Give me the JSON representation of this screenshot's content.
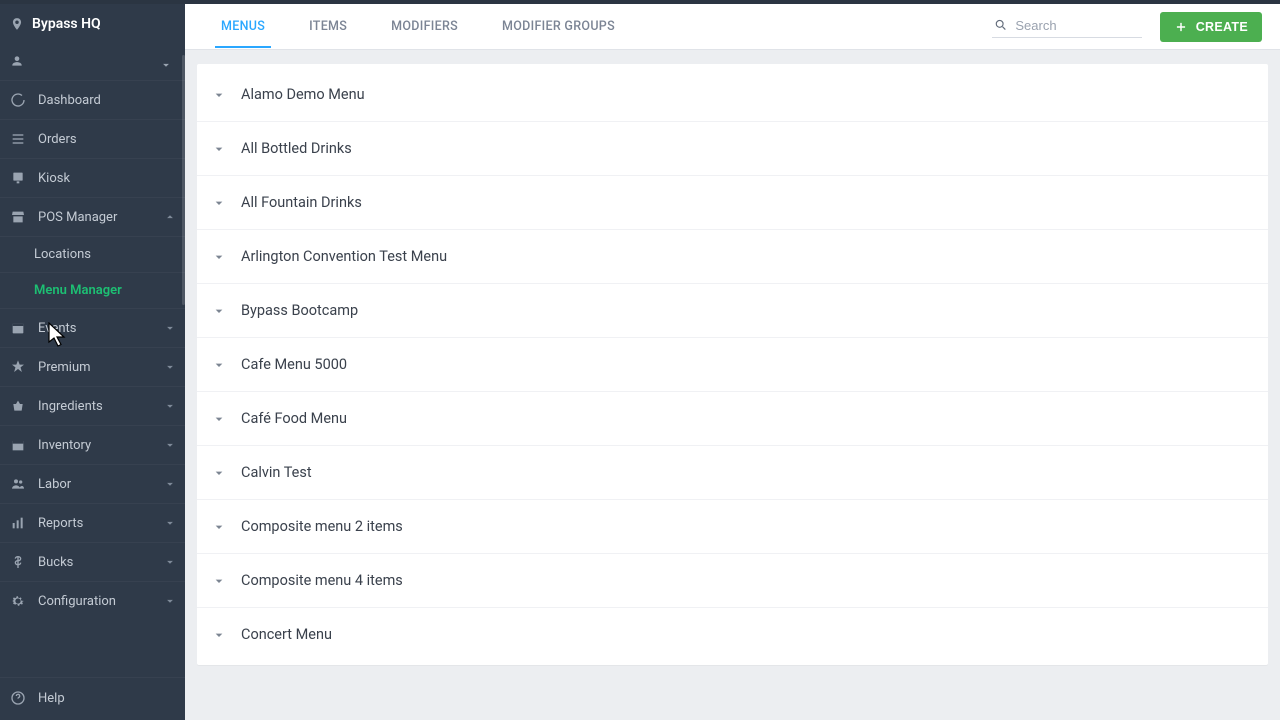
{
  "brand": {
    "name": "Bypass HQ"
  },
  "sidebar": {
    "items": [
      {
        "label": "Dashboard",
        "icon": "refresh",
        "expandable": false
      },
      {
        "label": "Orders",
        "icon": "list",
        "expandable": false
      },
      {
        "label": "Kiosk",
        "icon": "kiosk",
        "expandable": false
      },
      {
        "label": "POS Manager",
        "icon": "store",
        "expandable": true,
        "expanded": true,
        "children": [
          {
            "label": "Locations",
            "active": false
          },
          {
            "label": "Menu Manager",
            "active": true
          }
        ]
      },
      {
        "label": "Events",
        "icon": "calendar",
        "expandable": true
      },
      {
        "label": "Premium",
        "icon": "star",
        "expandable": true
      },
      {
        "label": "Ingredients",
        "icon": "basket",
        "expandable": true
      },
      {
        "label": "Inventory",
        "icon": "box",
        "expandable": true
      },
      {
        "label": "Labor",
        "icon": "people",
        "expandable": true
      },
      {
        "label": "Reports",
        "icon": "bars",
        "expandable": true
      },
      {
        "label": "Bucks",
        "icon": "dollar",
        "expandable": true
      },
      {
        "label": "Configuration",
        "icon": "gear",
        "expandable": true
      }
    ],
    "help_label": "Help"
  },
  "topbar": {
    "tabs": [
      {
        "label": "MENUS",
        "active": true
      },
      {
        "label": "ITEMS",
        "active": false
      },
      {
        "label": "MODIFIERS",
        "active": false
      },
      {
        "label": "MODIFIER GROUPS",
        "active": false
      }
    ],
    "search_placeholder": "Search",
    "create_label": "CREATE"
  },
  "menus": [
    "Alamo Demo Menu",
    "All Bottled Drinks",
    "All Fountain Drinks",
    "Arlington Convention Test Menu",
    "Bypass Bootcamp",
    "Cafe Menu 5000",
    "Café Food Menu",
    "Calvin Test",
    "Composite menu 2 items",
    "Composite menu 4 items",
    "Concert Menu"
  ],
  "colors": {
    "sidebar_bg": "#2f3a49",
    "accent": "#2aa7ff",
    "create": "#4caf50",
    "active_sub": "#1dbf73"
  }
}
